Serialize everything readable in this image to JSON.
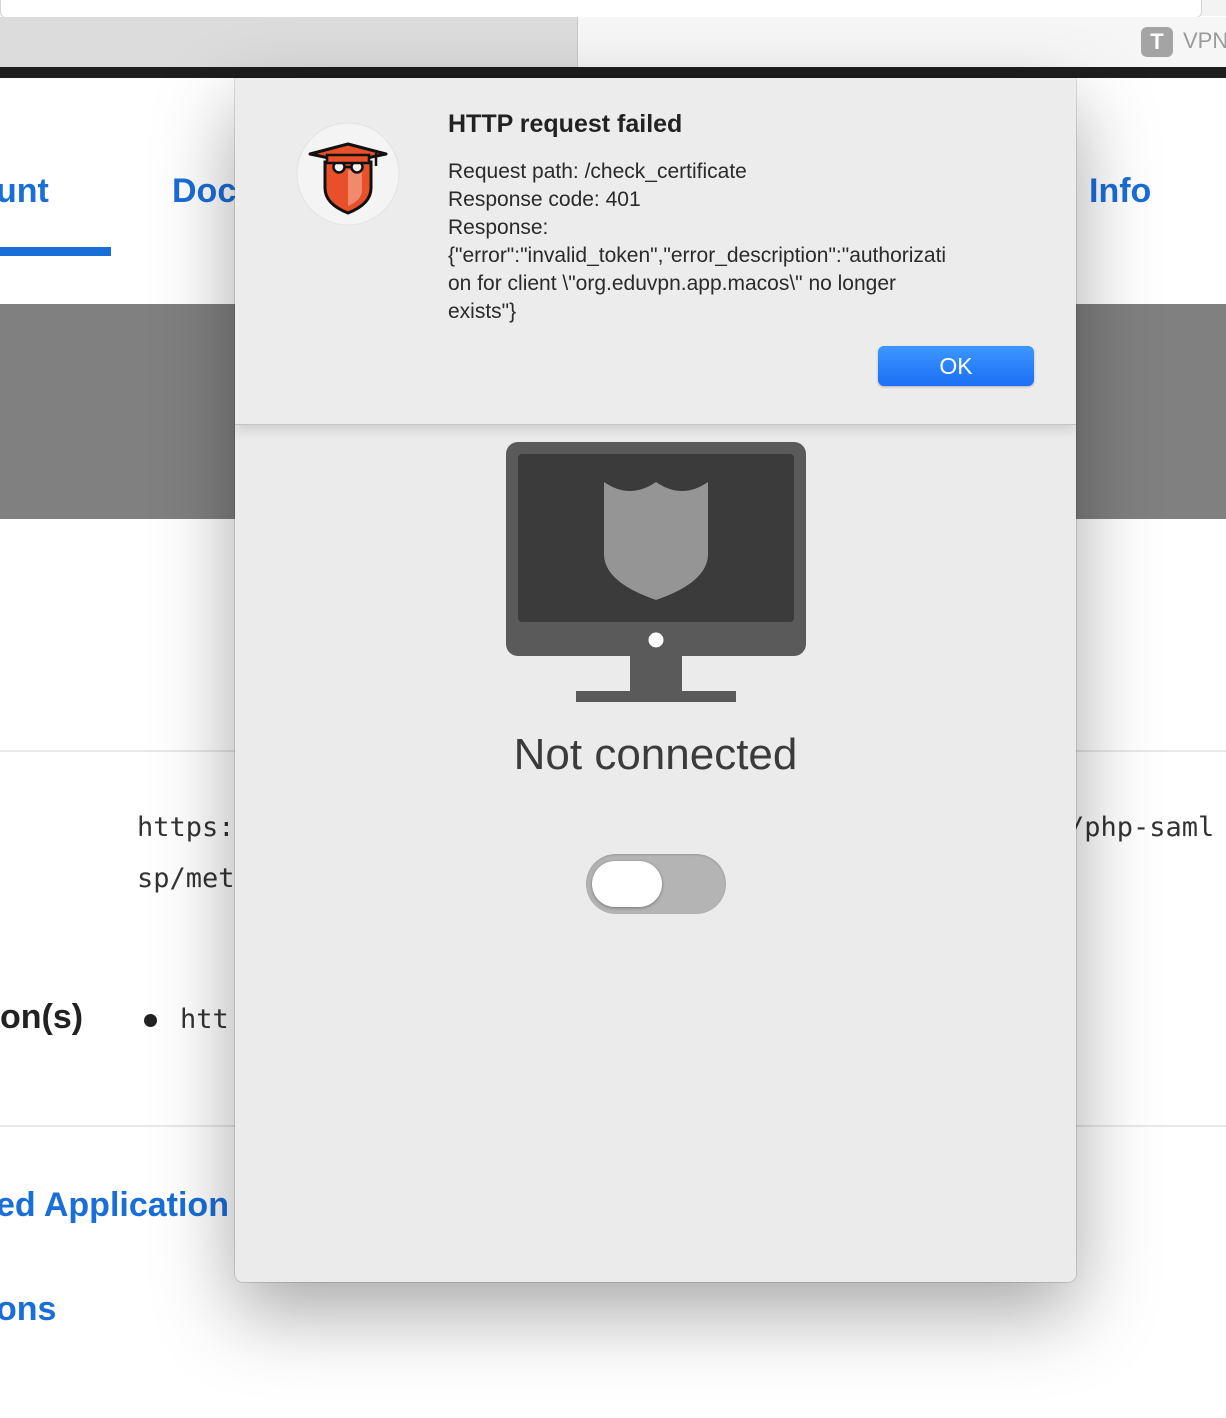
{
  "browser": {
    "inactive_tab": {
      "favicon_letter": "T",
      "title": "VPN"
    }
  },
  "page": {
    "nav": [
      "unt",
      "Doc",
      "Info"
    ],
    "metadata_url_line1_left": "https:",
    "metadata_url_line1_right": "/php-saml",
    "metadata_url_line2": "sp/met",
    "field_label": "on(s)",
    "list_item_text": "htt",
    "section_links": [
      "ed Application",
      "ons"
    ]
  },
  "app": {
    "status": "Not connected",
    "toggle": {
      "on": false
    }
  },
  "alert": {
    "title": "HTTP request failed",
    "body_lines": [
      "Request path: /check_certificate",
      "Response code: 401",
      "Response:",
      "{\"error\":\"invalid_token\",\"error_description\":\"authorizati",
      "on for client \\\"org.eduvpn.app.macos\\\" no longer",
      "exists\"}"
    ],
    "ok_label": "OK"
  },
  "colors": {
    "link_blue": "#1a6ed8",
    "button_blue": "#1a6ff5",
    "logo_orange": "#e8502a"
  },
  "icons": {
    "app_logo": "eduvpn-logo-icon",
    "monitor": "monitor-shield-icon"
  }
}
